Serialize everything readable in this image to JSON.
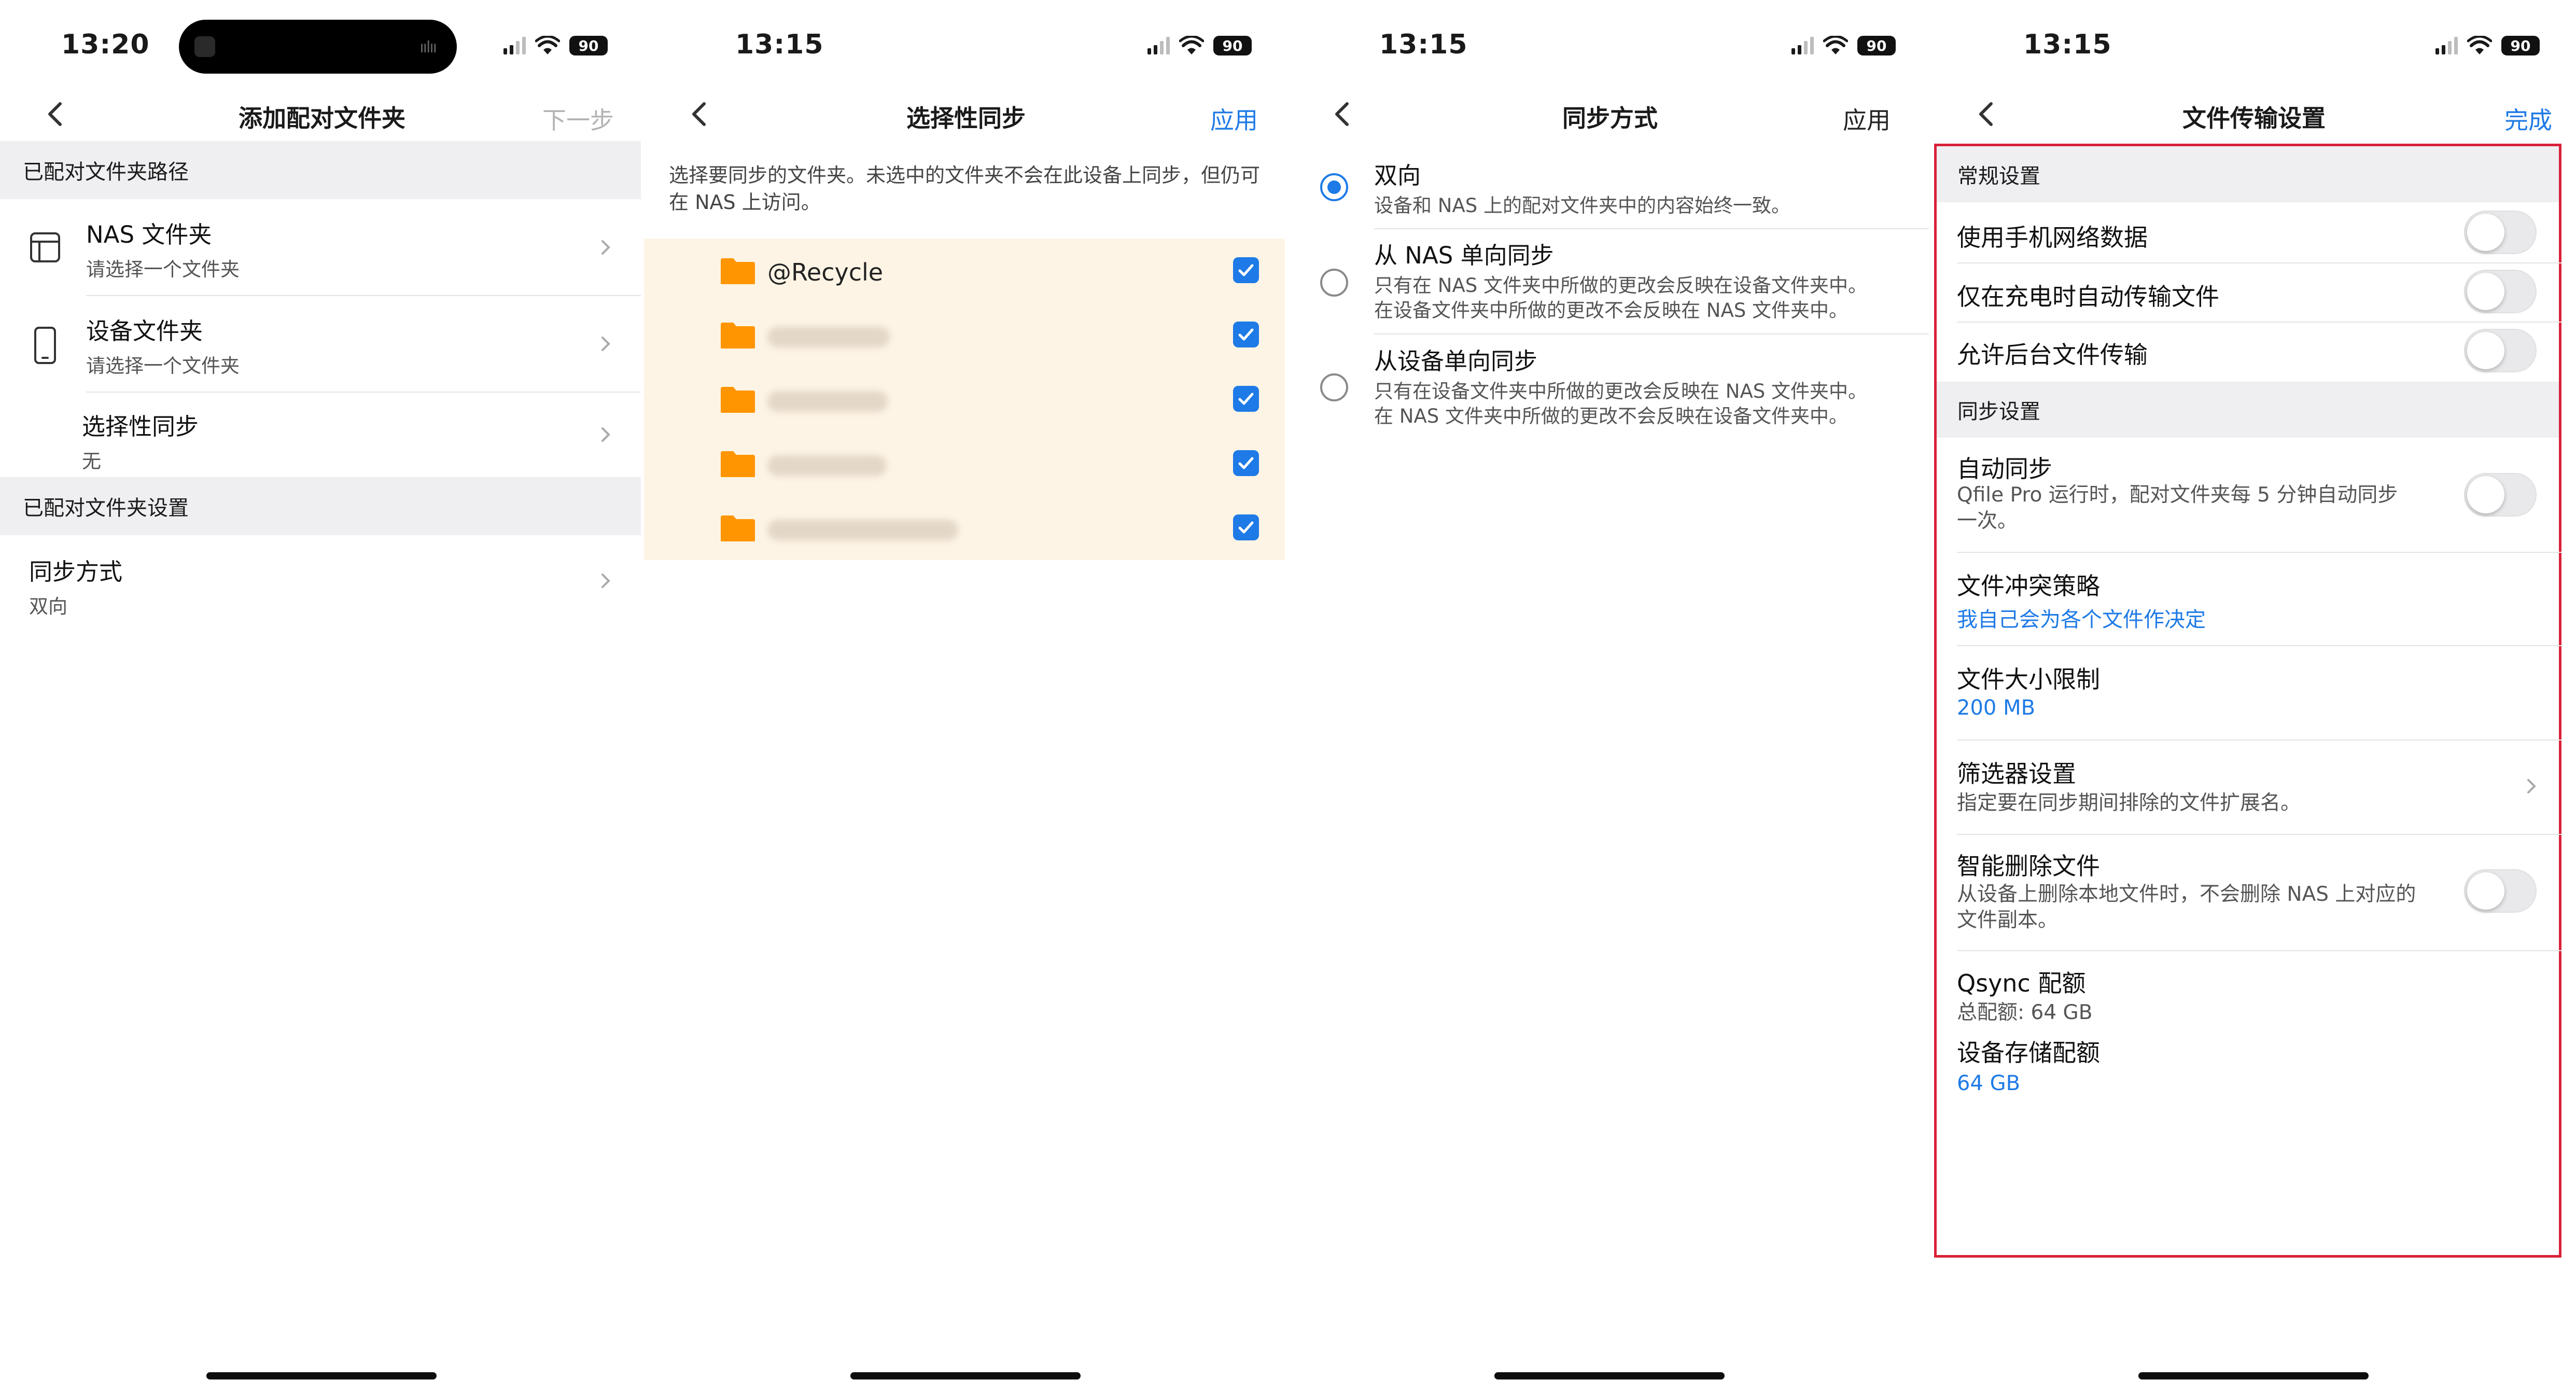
{
  "statusbar": {
    "p1_time": "13:20",
    "p2_time": "13:15",
    "p3_time": "13:15",
    "p4_time": "13:15",
    "battery": "90"
  },
  "screen1": {
    "title": "添加配对文件夹",
    "action": "下一步",
    "section_paths": "已配对文件夹路径",
    "nas_folder": {
      "title": "NAS 文件夹",
      "subtitle": "请选择一个文件夹"
    },
    "device_folder": {
      "title": "设备文件夹",
      "subtitle": "请选择一个文件夹"
    },
    "selective_sync": {
      "title": "选择性同步",
      "subtitle": "无"
    },
    "section_settings": "已配对文件夹设置",
    "sync_method": {
      "title": "同步方式",
      "subtitle": "双向"
    }
  },
  "screen2": {
    "title": "选择性同步",
    "action": "应用",
    "hint": "选择要同步的文件夹。未选中的文件夹不会在此设备上同步，但仍可在 NAS 上访问。",
    "folders": [
      {
        "name": "@Recycle",
        "checked": true
      },
      {
        "name": "",
        "checked": true,
        "blurred": true
      },
      {
        "name": "",
        "checked": true,
        "blurred": true
      },
      {
        "name": "",
        "checked": true,
        "blurred": true
      },
      {
        "name": "",
        "checked": true,
        "blurred": true
      }
    ],
    "folder_color": "#ff9500"
  },
  "screen3": {
    "title": "同步方式",
    "action": "应用",
    "options": [
      {
        "title": "双向",
        "desc1": "设备和 NAS 上的配对文件夹中的内容始终一致。",
        "desc2": "",
        "selected": true
      },
      {
        "title": "从 NAS 单向同步",
        "desc1": "只有在 NAS 文件夹中所做的更改会反映在设备文件夹中。",
        "desc2": "在设备文件夹中所做的更改不会反映在 NAS 文件夹中。",
        "selected": false
      },
      {
        "title": "从设备单向同步",
        "desc1": "只有在设备文件夹中所做的更改会反映在 NAS 文件夹中。",
        "desc2": "在 NAS 文件夹中所做的更改不会反映在设备文件夹中。",
        "selected": false
      }
    ]
  },
  "screen4": {
    "title": "文件传输设置",
    "action": "完成",
    "section_general": "常规设置",
    "mobile_data": "使用手机网络数据",
    "charging_only": "仅在充电时自动传输文件",
    "background": "允许后台文件传输",
    "section_sync": "同步设置",
    "auto_sync": {
      "title": "自动同步",
      "desc1": "Qfile Pro 运行时，配对文件夹每 5 分钟自动同步",
      "desc2": "一次。"
    },
    "conflict": {
      "title": "文件冲突策略",
      "value": "我自己会为各个文件作决定"
    },
    "size_limit": {
      "title": "文件大小限制",
      "value": "200 MB"
    },
    "filter": {
      "title": "筛选器设置",
      "desc": "指定要在同步期间排除的文件扩展名。"
    },
    "smart_delete": {
      "title": "智能删除文件",
      "desc1": "从设备上删除本地文件时，不会删除 NAS 上对应的",
      "desc2": "文件副本。"
    },
    "quota": {
      "title": "Qsync 配额",
      "total": "总配额: 64 GB",
      "device_title": "设备存储配额",
      "device_value": "64 GB"
    },
    "highlight_color": "#d9213a"
  },
  "colors": {
    "accent": "#1e7ae6",
    "section_bg": "#efeff2",
    "folder_area_bg": "#fdf4e5"
  }
}
